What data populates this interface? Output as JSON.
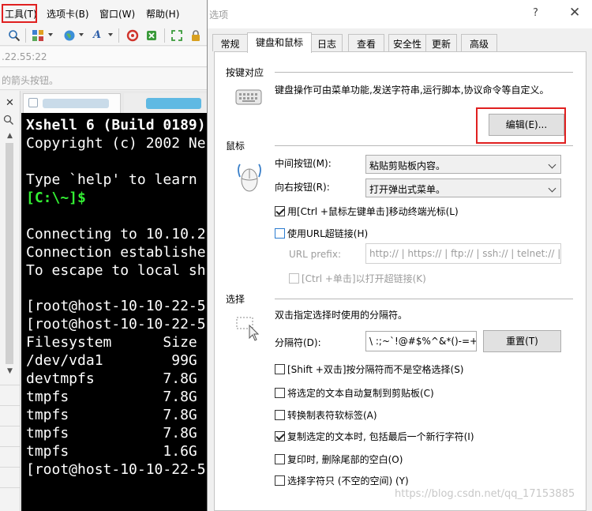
{
  "background_app": {
    "menu": {
      "tools": "工具(T)",
      "tabs": "选项卡(B)",
      "window": "窗口(W)",
      "help": "帮助(H)"
    },
    "address_partial": ".22.55:22",
    "hint_partial": "的箭头按钮。",
    "terminal_lines": [
      "Xshell 6 (Build 0189)",
      "Copyright (c) 2002 Ne",
      "",
      "Type `help' to learn",
      "[C:\\~]$",
      "",
      "Connecting to 10.10.2",
      "Connection establishe",
      "To escape to local sh",
      "",
      "[root@host-10-10-22-5",
      "[root@host-10-10-22-5",
      "Filesystem      Size",
      "/dev/vda1        99G",
      "devtmpfs        7.8G",
      "tmpfs           7.8G",
      "tmpfs           7.8G",
      "tmpfs           7.8G",
      "tmpfs           1.6G",
      "[root@host-10-10-22-5"
    ],
    "accent_highlight": "#e02020"
  },
  "dialog": {
    "title": "选项",
    "help_glyph": "?",
    "close_glyph": "✕",
    "tabs": [
      {
        "label": "常规"
      },
      {
        "label": "键盘和鼠标"
      },
      {
        "label": "日志"
      },
      {
        "label": "查看"
      },
      {
        "label": "安全性"
      },
      {
        "label": "更新"
      },
      {
        "label": "高级"
      }
    ],
    "keyboard": {
      "section_title": "按键对应",
      "description": "键盘操作可由菜单功能,发送字符串,运行脚本,协议命令等自定义。",
      "edit_button": "编辑(E)..."
    },
    "mouse": {
      "section_title": "鼠标",
      "middle_label": "中间按钮(M):",
      "middle_value": "粘贴剪贴板内容。",
      "right_label": "向右按钮(R):",
      "right_value": "打开弹出式菜单。",
      "ctrl_move_label": "用[Ctrl +鼠标左键单击]移动终端光标(L)",
      "ctrl_move_checked": true,
      "url_link_label": "使用URL超链接(H)",
      "url_link_checked": false,
      "url_prefix_label": "URL prefix:",
      "url_prefix_value": "http:// | https:// | ftp:// | ssh:// | telnet:// |",
      "ctrl_click_label": "[Ctrl +单击]以打开超链接(K)",
      "ctrl_click_checked": false
    },
    "selection": {
      "section_title": "选择",
      "description": "双击指定选择时使用的分隔符。",
      "delimiter_label": "分隔符(D):",
      "delimiter_value": "\\ :;~`!@#$%^&*()-=+|[]",
      "reset_button": "重置(T)",
      "options": [
        {
          "label": "[Shift +双击]按分隔符而不是空格选择(S)",
          "checked": false
        },
        {
          "label": "将选定的文本自动复制到剪贴板(C)",
          "checked": false
        },
        {
          "label": "转换制表符软标签(A)",
          "checked": false
        },
        {
          "label": "复制选定的文本时, 包括最后一个新行字符(I)",
          "checked": true
        },
        {
          "label": "复印时, 删除尾部的空白(O)",
          "checked": false
        },
        {
          "label": "选择字符只 (不空的空间) (Y)",
          "checked": false
        }
      ]
    }
  },
  "watermark": "https://blog.csdn.net/qq_17153885"
}
